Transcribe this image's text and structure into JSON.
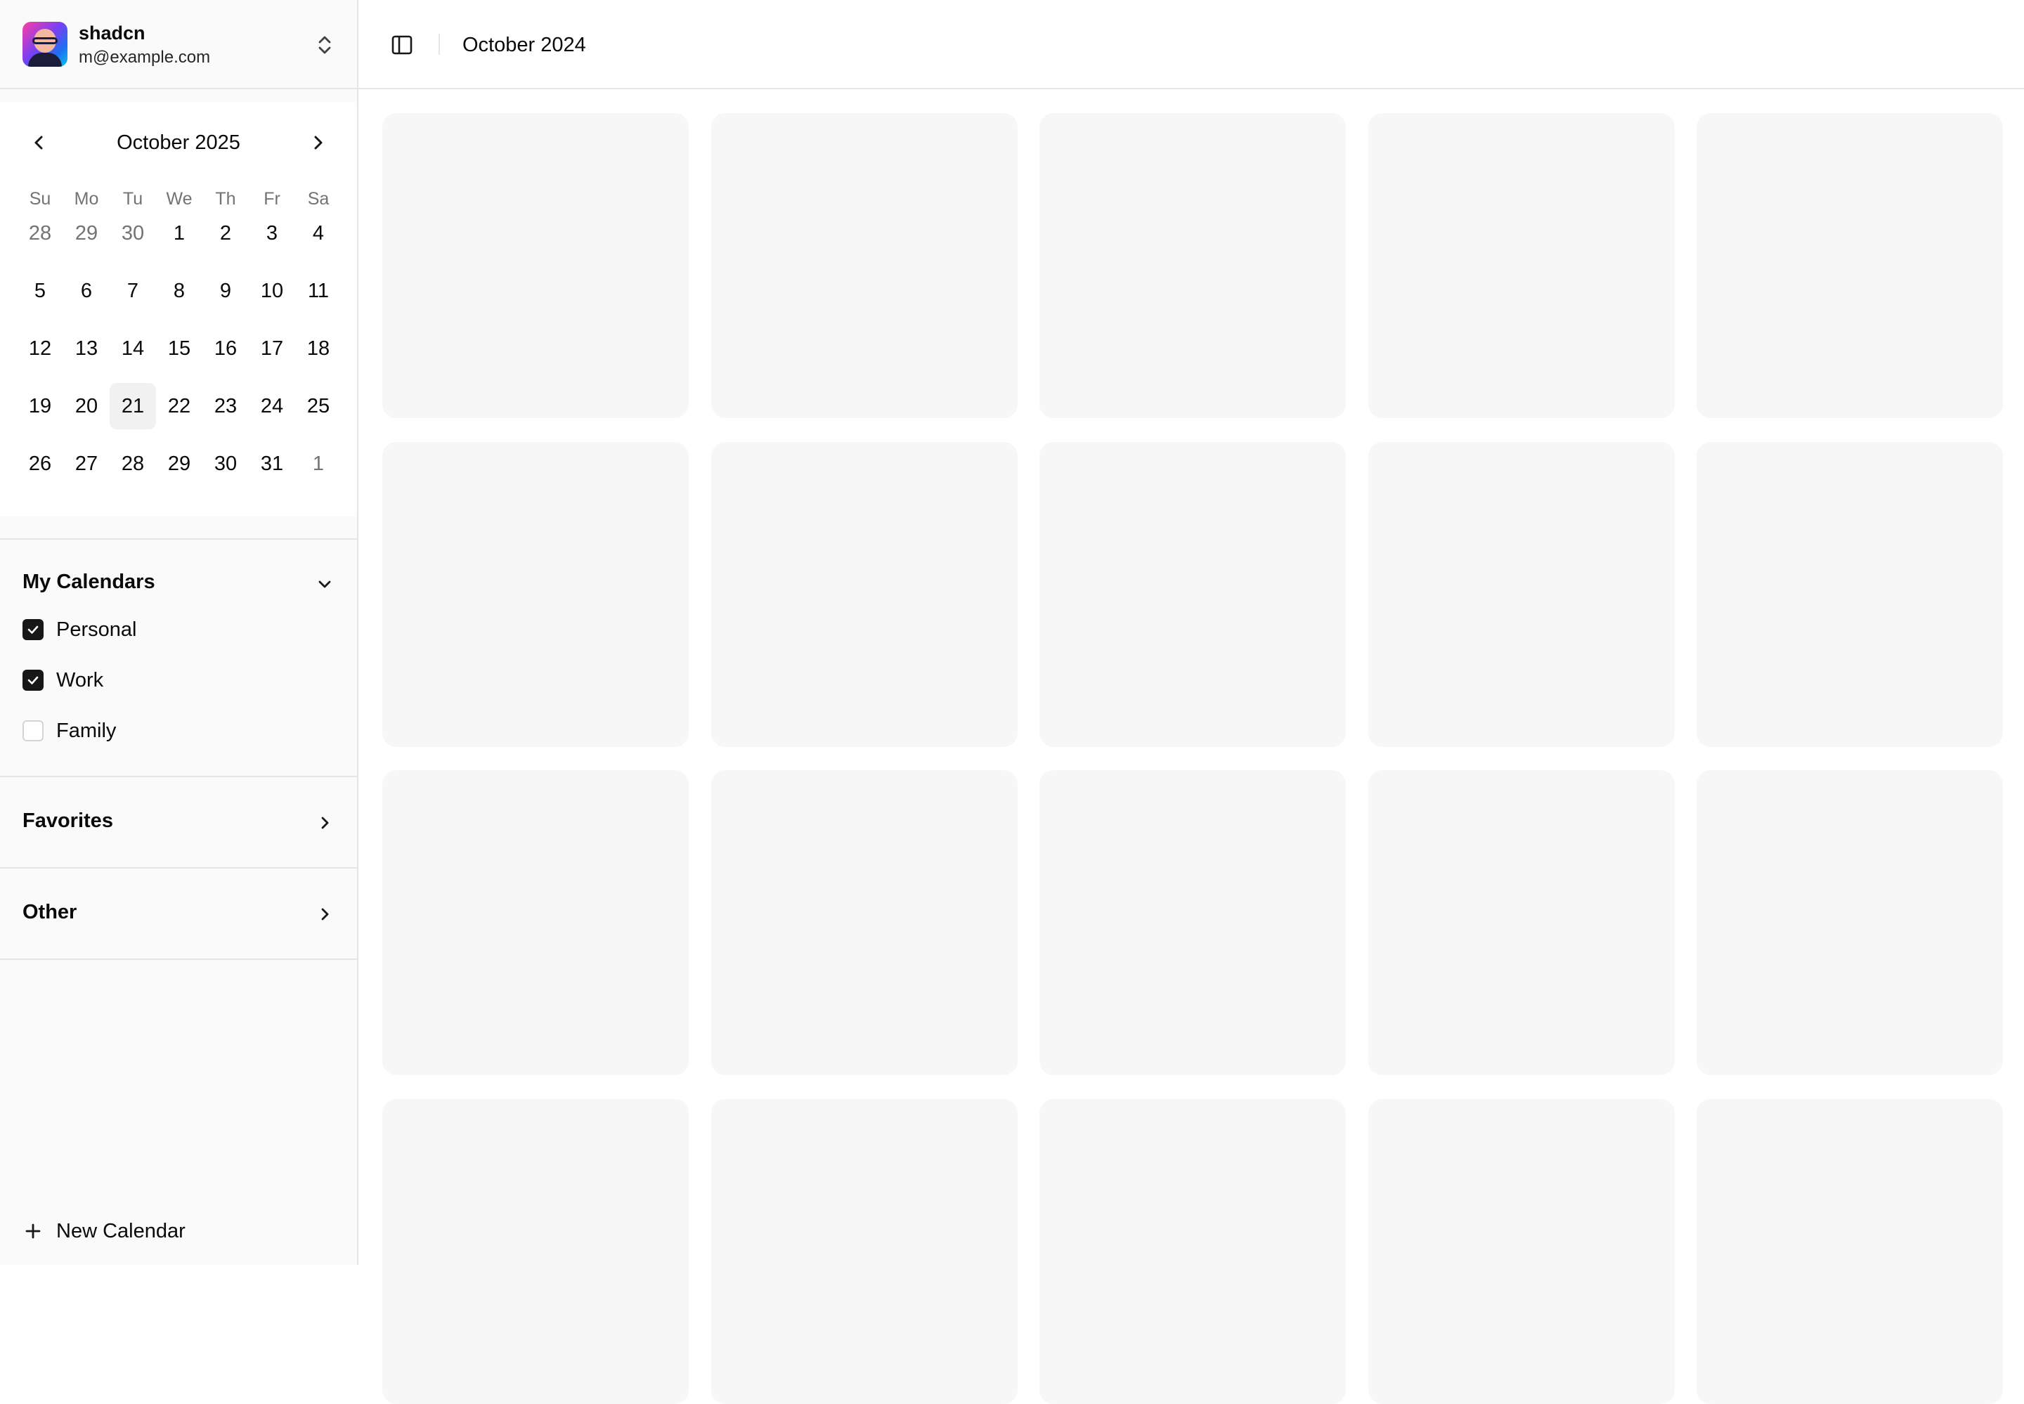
{
  "user": {
    "name": "shadcn",
    "email": "m@example.com"
  },
  "mini_calendar": {
    "title": "October 2025",
    "weekdays": [
      "Su",
      "Mo",
      "Tu",
      "We",
      "Th",
      "Fr",
      "Sa"
    ],
    "days": [
      {
        "label": "28",
        "outside": true
      },
      {
        "label": "29",
        "outside": true
      },
      {
        "label": "30",
        "outside": true
      },
      {
        "label": "1"
      },
      {
        "label": "2"
      },
      {
        "label": "3"
      },
      {
        "label": "4"
      },
      {
        "label": "5"
      },
      {
        "label": "6"
      },
      {
        "label": "7"
      },
      {
        "label": "8"
      },
      {
        "label": "9"
      },
      {
        "label": "10"
      },
      {
        "label": "11"
      },
      {
        "label": "12"
      },
      {
        "label": "13"
      },
      {
        "label": "14"
      },
      {
        "label": "15"
      },
      {
        "label": "16"
      },
      {
        "label": "17"
      },
      {
        "label": "18"
      },
      {
        "label": "19"
      },
      {
        "label": "20"
      },
      {
        "label": "21",
        "today": true
      },
      {
        "label": "22"
      },
      {
        "label": "23"
      },
      {
        "label": "24"
      },
      {
        "label": "25"
      },
      {
        "label": "26"
      },
      {
        "label": "27"
      },
      {
        "label": "28"
      },
      {
        "label": "29"
      },
      {
        "label": "30"
      },
      {
        "label": "31"
      },
      {
        "label": "1",
        "outside": true
      }
    ]
  },
  "my_calendars": {
    "label": "My Calendars",
    "items": [
      {
        "label": "Personal",
        "checked": true
      },
      {
        "label": "Work",
        "checked": true
      },
      {
        "label": "Family",
        "checked": false
      }
    ]
  },
  "favorites": {
    "label": "Favorites"
  },
  "other": {
    "label": "Other"
  },
  "new_calendar": {
    "label": "New Calendar"
  },
  "topbar": {
    "title": "October 2024"
  },
  "colors": {
    "sidebar_bg": "#fafafa",
    "placeholder_bg": "#f7f7f7",
    "checkbox_checked": "#171717",
    "border": "#e5e5e5"
  },
  "placeholder_grid": {
    "columns": 5,
    "rows": 4
  }
}
